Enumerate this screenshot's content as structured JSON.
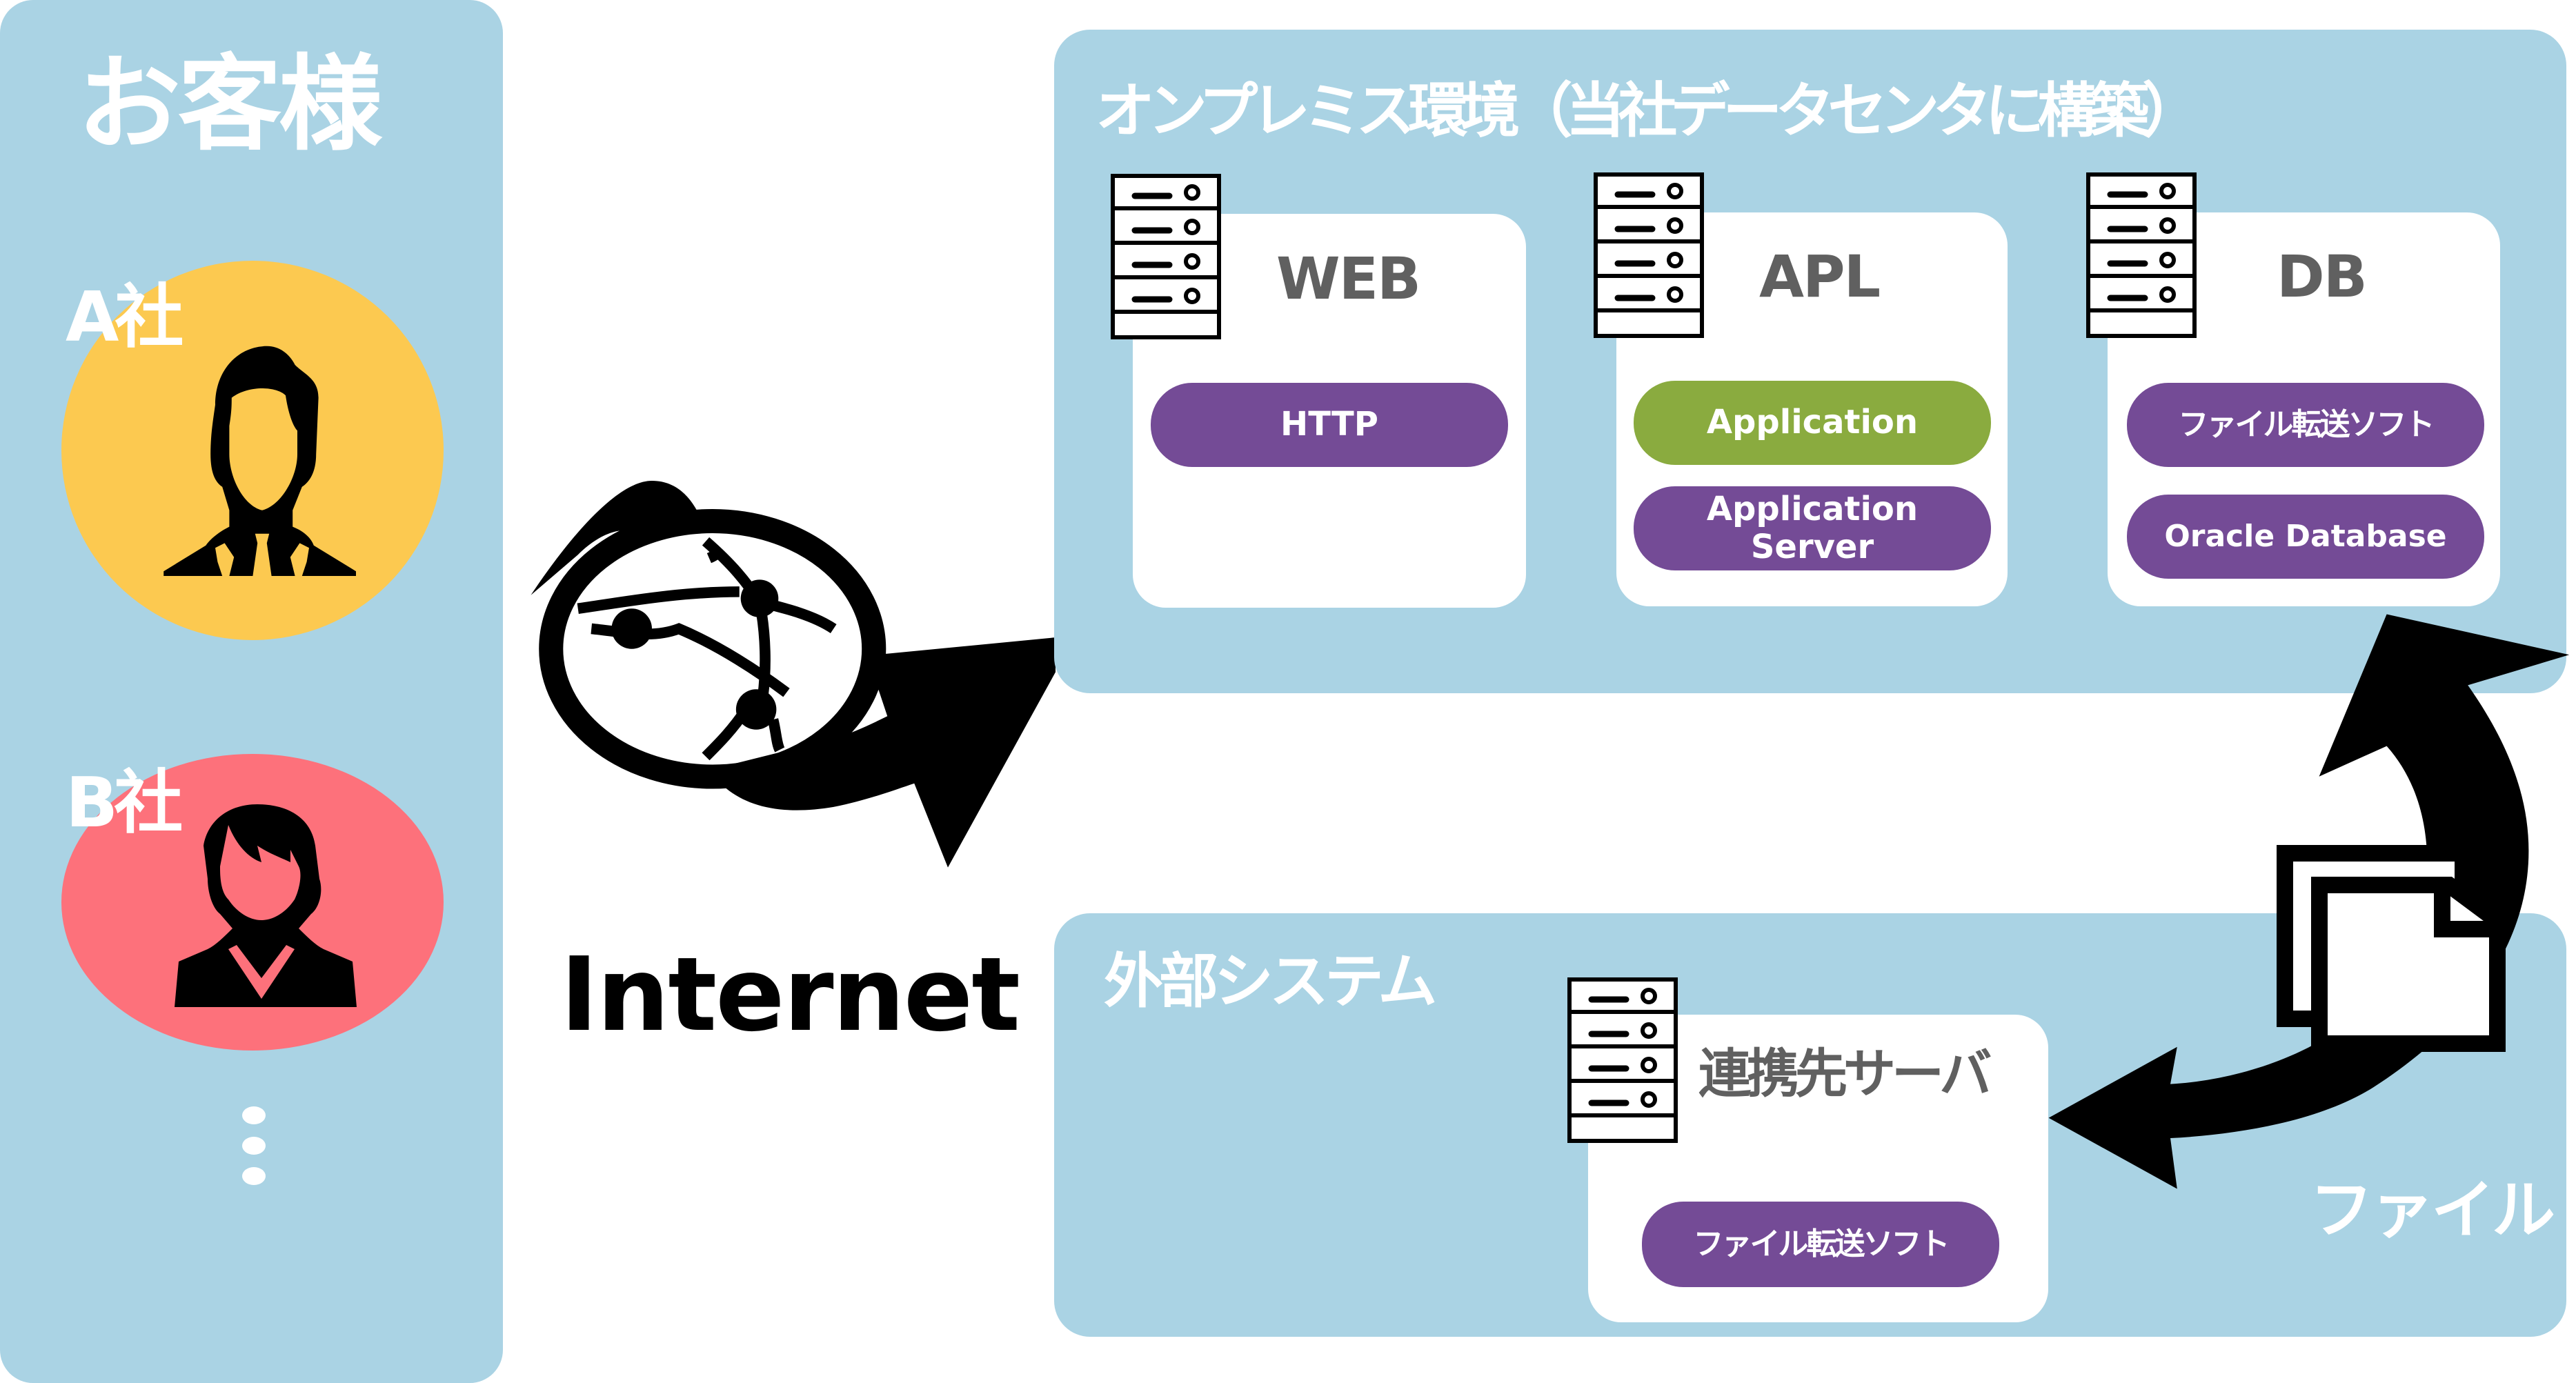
{
  "customers": {
    "title": "お客様",
    "companies": [
      {
        "label": "A社",
        "color": "#fcc950",
        "icon": "businessman-icon"
      },
      {
        "label": "B社",
        "color": "#fd717b",
        "icon": "businesswoman-icon"
      }
    ],
    "more_icon": "vertical-ellipsis-icon"
  },
  "internet": {
    "label": "Internet",
    "icon": "globe-network-icon"
  },
  "onprem": {
    "title": "オンプレミス環境（当社データセンタに構築）",
    "servers": [
      {
        "name": "WEB",
        "components": [
          {
            "label": "HTTP",
            "color": "#744b96"
          }
        ]
      },
      {
        "name": "APL",
        "components": [
          {
            "label": "Application",
            "color": "#8aab3f"
          },
          {
            "label": "Application Server",
            "line1": "Application",
            "line2": "Server",
            "color": "#744b96"
          }
        ]
      },
      {
        "name": "DB",
        "components": [
          {
            "label": "ファイル転送ソフト",
            "color": "#744b96"
          },
          {
            "label": "Oracle Database",
            "color": "#744b96"
          }
        ]
      }
    ]
  },
  "external": {
    "title": "外部システム",
    "server": {
      "name": "連携先サーバ",
      "components": [
        {
          "label": "ファイル転送ソフト",
          "color": "#744b96"
        }
      ]
    }
  },
  "file": {
    "label": "ファイル",
    "icon": "document-copy-icon"
  },
  "colors": {
    "panel_bg": "#aad3e4",
    "box_bg": "#ffffff",
    "component_purple": "#744b96",
    "component_green": "#8aab3f",
    "box_title": "#606060",
    "company_a": "#fcc950",
    "company_b": "#fd717b"
  }
}
